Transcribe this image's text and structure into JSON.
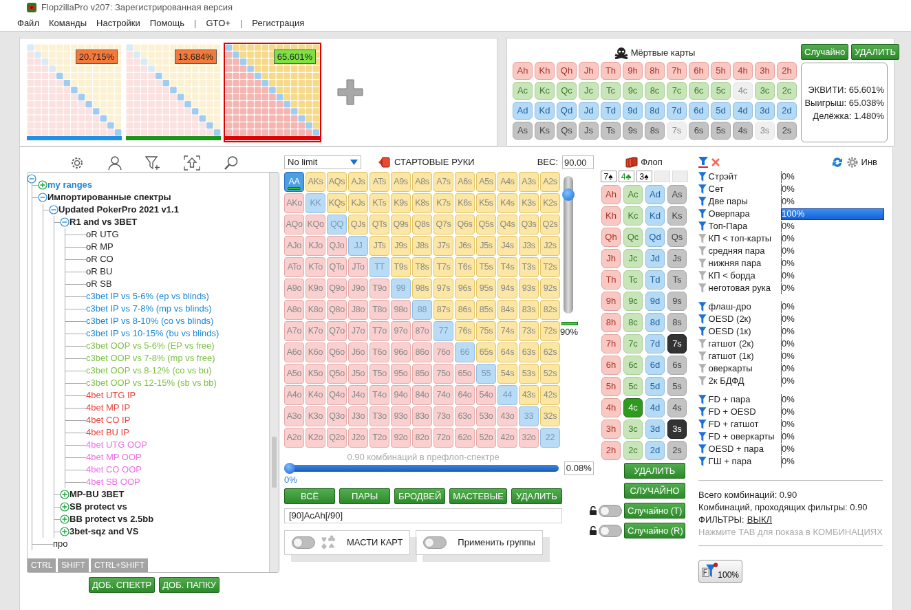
{
  "window": {
    "title": "FlopzillaPro v207: Зарегистрированная версия"
  },
  "menu": [
    {
      "label": "Файл",
      "kind": "item"
    },
    {
      "label": "Команды",
      "kind": "item"
    },
    {
      "label": "Настройки",
      "kind": "item"
    },
    {
      "label": "Помощь",
      "kind": "item"
    },
    {
      "label": "|",
      "kind": "separator"
    },
    {
      "label": "GTO+",
      "kind": "item"
    },
    {
      "label": "|",
      "kind": "separator"
    },
    {
      "label": "Регистрация",
      "kind": "item"
    }
  ],
  "ranges": [
    {
      "percent": "20.715%",
      "color": "#1e90e8",
      "selected": false
    },
    {
      "percent": "13.684%",
      "color": "#1a951a",
      "selected": false
    },
    {
      "percent": "65.601%",
      "color": "#e00000",
      "selected": true
    }
  ],
  "dead_cards": {
    "title": "Мёртвые карты",
    "buttons": [
      "Случайно",
      "УДАЛИТЬ"
    ],
    "rows": [
      {
        "kind": "hearts",
        "cards": [
          {
            "label": "Ah",
            "disabled": false
          },
          {
            "label": "Kh",
            "disabled": false
          },
          {
            "label": "Qh",
            "disabled": false
          },
          {
            "label": "Jh",
            "disabled": false
          },
          {
            "label": "Th",
            "disabled": false
          },
          {
            "label": "9h",
            "disabled": false
          },
          {
            "label": "8h",
            "disabled": false
          },
          {
            "label": "7h",
            "disabled": false
          },
          {
            "label": "6h",
            "disabled": false
          },
          {
            "label": "5h",
            "disabled": false
          },
          {
            "label": "4h",
            "disabled": false
          },
          {
            "label": "3h",
            "disabled": false
          },
          {
            "label": "2h",
            "disabled": false
          }
        ]
      },
      {
        "kind": "clubs",
        "cards": [
          {
            "label": "Ac",
            "disabled": false
          },
          {
            "label": "Kc",
            "disabled": false
          },
          {
            "label": "Qc",
            "disabled": false
          },
          {
            "label": "Jc",
            "disabled": false
          },
          {
            "label": "Tc",
            "disabled": false
          },
          {
            "label": "9c",
            "disabled": false
          },
          {
            "label": "8c",
            "disabled": false
          },
          {
            "label": "7c",
            "disabled": false
          },
          {
            "label": "6c",
            "disabled": false
          },
          {
            "label": "5c",
            "disabled": false
          },
          {
            "label": "4c",
            "disabled": true
          },
          {
            "label": "3c",
            "disabled": false
          },
          {
            "label": "2c",
            "disabled": false
          }
        ]
      },
      {
        "kind": "diamonds",
        "cards": [
          {
            "label": "Ad",
            "disabled": false
          },
          {
            "label": "Kd",
            "disabled": false
          },
          {
            "label": "Qd",
            "disabled": false
          },
          {
            "label": "Jd",
            "disabled": false
          },
          {
            "label": "Td",
            "disabled": false
          },
          {
            "label": "9d",
            "disabled": false
          },
          {
            "label": "8d",
            "disabled": false
          },
          {
            "label": "7d",
            "disabled": false
          },
          {
            "label": "6d",
            "disabled": false
          },
          {
            "label": "5d",
            "disabled": false
          },
          {
            "label": "4d",
            "disabled": false
          },
          {
            "label": "3d",
            "disabled": false
          },
          {
            "label": "2d",
            "disabled": false
          }
        ]
      },
      {
        "kind": "spades",
        "cards": [
          {
            "label": "As",
            "disabled": false
          },
          {
            "label": "Ks",
            "disabled": false
          },
          {
            "label": "Qs",
            "disabled": false
          },
          {
            "label": "Js",
            "disabled": false
          },
          {
            "label": "Ts",
            "disabled": false
          },
          {
            "label": "9s",
            "disabled": false
          },
          {
            "label": "8s",
            "disabled": false
          },
          {
            "label": "7s",
            "disabled": true
          },
          {
            "label": "6s",
            "disabled": false
          },
          {
            "label": "5s",
            "disabled": false
          },
          {
            "label": "4s",
            "disabled": false
          },
          {
            "label": "3s",
            "disabled": true
          },
          {
            "label": "2s",
            "disabled": false
          }
        ]
      }
    ]
  },
  "equity": {
    "lines": [
      "ЭКВИТИ: 65.601%",
      "Выигрыш: 65.038%",
      "Делёжка: 1.480%"
    ]
  },
  "tree": {
    "expanded": true,
    "children": [
      {
        "label": "my ranges",
        "kind": "folder",
        "color": "#1a88d6",
        "expanded": false
      },
      {
        "label": "Импортированные спектры",
        "kind": "folder",
        "color": "#222222",
        "expanded": true,
        "children": [
          {
            "label": "Updated PokerPro 2021 v1.1",
            "kind": "folder",
            "color": "#222222",
            "expanded": true,
            "children": [
              {
                "label": "R1 and vs 3BET",
                "kind": "folder",
                "color": "#222222",
                "expanded": true,
                "children": [
                  {
                    "label": "oR UTG",
                    "kind": "range",
                    "color": "#222222"
                  },
                  {
                    "label": "oR MP",
                    "kind": "range",
                    "color": "#222222"
                  },
                  {
                    "label": "oR CO",
                    "kind": "range",
                    "color": "#222222"
                  },
                  {
                    "label": "oR BU",
                    "kind": "range",
                    "color": "#222222"
                  },
                  {
                    "label": "oR SB",
                    "kind": "range",
                    "color": "#222222"
                  },
                  {
                    "label": "c3bet IP vs 5-6% (ep vs blinds)",
                    "kind": "range",
                    "color": "#1a88d6"
                  },
                  {
                    "label": "c3bet IP vs 7-8% (mp vs blinds)",
                    "kind": "range",
                    "color": "#1a88d6"
                  },
                  {
                    "label": "c3bet IP vs 8-10% (co vs blinds)",
                    "kind": "range",
                    "color": "#1a88d6"
                  },
                  {
                    "label": "c3bet IP vs 10-15% (bu vs blinds)",
                    "kind": "range",
                    "color": "#1a88d6"
                  },
                  {
                    "label": "c3bet OOP vs 5-6% (EP vs free)",
                    "kind": "range",
                    "color": "#7cc142"
                  },
                  {
                    "label": "c3bet OOP vs 7-8% (mp vs free)",
                    "kind": "range",
                    "color": "#7cc142"
                  },
                  {
                    "label": "c3bet OOP vs 8-12% (co vs bu)",
                    "kind": "range",
                    "color": "#7cc142"
                  },
                  {
                    "label": "c3bet OOP vs 12-15% (sb vs bb)",
                    "kind": "range",
                    "color": "#7cc142"
                  },
                  {
                    "label": "4bet UTG IP",
                    "kind": "range",
                    "color": "#e8433a"
                  },
                  {
                    "label": "4bet MP IP",
                    "kind": "range",
                    "color": "#e8433a"
                  },
                  {
                    "label": "4bet CO IP",
                    "kind": "range",
                    "color": "#e8433a"
                  },
                  {
                    "label": "4bet BU IP",
                    "kind": "range",
                    "color": "#e8433a"
                  },
                  {
                    "label": "4bet UTG OOP",
                    "kind": "range",
                    "color": "#ee6fe8"
                  },
                  {
                    "label": "4bet MP OOP",
                    "kind": "range",
                    "color": "#ee6fe8"
                  },
                  {
                    "label": "4bet CO OOP",
                    "kind": "range",
                    "color": "#ee6fe8"
                  },
                  {
                    "label": "4bet SB OOP",
                    "kind": "range",
                    "color": "#ee6fe8"
                  }
                ]
              },
              {
                "label": "MP-BU 3BET",
                "kind": "folder",
                "color": "#222222",
                "expanded": false
              },
              {
                "label": "SB protect vs",
                "kind": "folder",
                "color": "#222222",
                "expanded": false
              },
              {
                "label": "BB protect vs 2.5bb",
                "kind": "folder",
                "color": "#222222",
                "expanded": false
              },
              {
                "label": "3bet-sqz and VS",
                "kind": "folder",
                "color": "#222222",
                "expanded": false
              }
            ]
          }
        ]
      },
      {
        "label": "про",
        "kind": "range",
        "color": "#222222"
      }
    ]
  },
  "tree_tabs": [
    "CTRL",
    "SHIFT",
    "CTRL+SHIFT"
  ],
  "tree_buttons": [
    "ДОБ. СПЕКТР",
    "ДОБ. ПАПКУ"
  ],
  "hands": {
    "game": "No limit",
    "title": "СТАРТОВЫЕ РУКИ",
    "weight_label": "ВЕС:",
    "weight": "90.00",
    "matrix": [
      [
        {
          "label": "AA",
          "selected": true
        },
        {
          "label": "AKs",
          "selected": false
        },
        {
          "label": "AQs",
          "selected": false
        },
        {
          "label": "AJs",
          "selected": false
        },
        {
          "label": "ATs",
          "selected": false
        },
        {
          "label": "A9s",
          "selected": false
        },
        {
          "label": "A8s",
          "selected": false
        },
        {
          "label": "A7s",
          "selected": false
        },
        {
          "label": "A6s",
          "selected": false
        },
        {
          "label": "A5s",
          "selected": false
        },
        {
          "label": "A4s",
          "selected": false
        },
        {
          "label": "A3s",
          "selected": false
        },
        {
          "label": "A2s",
          "selected": false
        }
      ],
      [
        {
          "label": "AKo",
          "selected": false
        },
        {
          "label": "KK",
          "selected": false
        },
        {
          "label": "KQs",
          "selected": false
        },
        {
          "label": "KJs",
          "selected": false
        },
        {
          "label": "KTs",
          "selected": false
        },
        {
          "label": "K9s",
          "selected": false
        },
        {
          "label": "K8s",
          "selected": false
        },
        {
          "label": "K7s",
          "selected": false
        },
        {
          "label": "K6s",
          "selected": false
        },
        {
          "label": "K5s",
          "selected": false
        },
        {
          "label": "K4s",
          "selected": false
        },
        {
          "label": "K3s",
          "selected": false
        },
        {
          "label": "K2s",
          "selected": false
        }
      ],
      [
        {
          "label": "AQo",
          "selected": false
        },
        {
          "label": "KQo",
          "selected": false
        },
        {
          "label": "QQ",
          "selected": false
        },
        {
          "label": "QJs",
          "selected": false
        },
        {
          "label": "QTs",
          "selected": false
        },
        {
          "label": "Q9s",
          "selected": false
        },
        {
          "label": "Q8s",
          "selected": false
        },
        {
          "label": "Q7s",
          "selected": false
        },
        {
          "label": "Q6s",
          "selected": false
        },
        {
          "label": "Q5s",
          "selected": false
        },
        {
          "label": "Q4s",
          "selected": false
        },
        {
          "label": "Q3s",
          "selected": false
        },
        {
          "label": "Q2s",
          "selected": false
        }
      ],
      [
        {
          "label": "AJo",
          "selected": false
        },
        {
          "label": "KJo",
          "selected": false
        },
        {
          "label": "QJo",
          "selected": false
        },
        {
          "label": "JJ",
          "selected": false
        },
        {
          "label": "JTs",
          "selected": false
        },
        {
          "label": "J9s",
          "selected": false
        },
        {
          "label": "J8s",
          "selected": false
        },
        {
          "label": "J7s",
          "selected": false
        },
        {
          "label": "J6s",
          "selected": false
        },
        {
          "label": "J5s",
          "selected": false
        },
        {
          "label": "J4s",
          "selected": false
        },
        {
          "label": "J3s",
          "selected": false
        },
        {
          "label": "J2s",
          "selected": false
        }
      ],
      [
        {
          "label": "ATo",
          "selected": false
        },
        {
          "label": "KTo",
          "selected": false
        },
        {
          "label": "QTo",
          "selected": false
        },
        {
          "label": "JTo",
          "selected": false
        },
        {
          "label": "TT",
          "selected": false
        },
        {
          "label": "T9s",
          "selected": false
        },
        {
          "label": "T8s",
          "selected": false
        },
        {
          "label": "T7s",
          "selected": false
        },
        {
          "label": "T6s",
          "selected": false
        },
        {
          "label": "T5s",
          "selected": false
        },
        {
          "label": "T4s",
          "selected": false
        },
        {
          "label": "T3s",
          "selected": false
        },
        {
          "label": "T2s",
          "selected": false
        }
      ],
      [
        {
          "label": "A9o",
          "selected": false
        },
        {
          "label": "K9o",
          "selected": false
        },
        {
          "label": "Q9o",
          "selected": false
        },
        {
          "label": "J9o",
          "selected": false
        },
        {
          "label": "T9o",
          "selected": false
        },
        {
          "label": "99",
          "selected": false
        },
        {
          "label": "98s",
          "selected": false
        },
        {
          "label": "97s",
          "selected": false
        },
        {
          "label": "96s",
          "selected": false
        },
        {
          "label": "95s",
          "selected": false
        },
        {
          "label": "94s",
          "selected": false
        },
        {
          "label": "93s",
          "selected": false
        },
        {
          "label": "92s",
          "selected": false
        }
      ],
      [
        {
          "label": "A8o",
          "selected": false
        },
        {
          "label": "K8o",
          "selected": false
        },
        {
          "label": "Q8o",
          "selected": false
        },
        {
          "label": "J8o",
          "selected": false
        },
        {
          "label": "T8o",
          "selected": false
        },
        {
          "label": "98o",
          "selected": false
        },
        {
          "label": "88",
          "selected": false
        },
        {
          "label": "87s",
          "selected": false
        },
        {
          "label": "86s",
          "selected": false
        },
        {
          "label": "85s",
          "selected": false
        },
        {
          "label": "84s",
          "selected": false
        },
        {
          "label": "83s",
          "selected": false
        },
        {
          "label": "82s",
          "selected": false
        }
      ],
      [
        {
          "label": "A7o",
          "selected": false
        },
        {
          "label": "K7o",
          "selected": false
        },
        {
          "label": "Q7o",
          "selected": false
        },
        {
          "label": "J7o",
          "selected": false
        },
        {
          "label": "T7o",
          "selected": false
        },
        {
          "label": "97o",
          "selected": false
        },
        {
          "label": "87o",
          "selected": false
        },
        {
          "label": "77",
          "selected": false
        },
        {
          "label": "76s",
          "selected": false
        },
        {
          "label": "75s",
          "selected": false
        },
        {
          "label": "74s",
          "selected": false
        },
        {
          "label": "73s",
          "selected": false
        },
        {
          "label": "72s",
          "selected": false
        }
      ],
      [
        {
          "label": "A6o",
          "selected": false
        },
        {
          "label": "K6o",
          "selected": false
        },
        {
          "label": "Q6o",
          "selected": false
        },
        {
          "label": "J6o",
          "selected": false
        },
        {
          "label": "T6o",
          "selected": false
        },
        {
          "label": "96o",
          "selected": false
        },
        {
          "label": "86o",
          "selected": false
        },
        {
          "label": "76o",
          "selected": false
        },
        {
          "label": "66",
          "selected": false
        },
        {
          "label": "65s",
          "selected": false
        },
        {
          "label": "64s",
          "selected": false
        },
        {
          "label": "63s",
          "selected": false
        },
        {
          "label": "62s",
          "selected": false
        }
      ],
      [
        {
          "label": "A5o",
          "selected": false
        },
        {
          "label": "K5o",
          "selected": false
        },
        {
          "label": "Q5o",
          "selected": false
        },
        {
          "label": "J5o",
          "selected": false
        },
        {
          "label": "T5o",
          "selected": false
        },
        {
          "label": "95o",
          "selected": false
        },
        {
          "label": "85o",
          "selected": false
        },
        {
          "label": "75o",
          "selected": false
        },
        {
          "label": "65o",
          "selected": false
        },
        {
          "label": "55",
          "selected": false
        },
        {
          "label": "54s",
          "selected": false
        },
        {
          "label": "53s",
          "selected": false
        },
        {
          "label": "52s",
          "selected": false
        }
      ],
      [
        {
          "label": "A4o",
          "selected": false
        },
        {
          "label": "K4o",
          "selected": false
        },
        {
          "label": "Q4o",
          "selected": false
        },
        {
          "label": "J4o",
          "selected": false
        },
        {
          "label": "T4o",
          "selected": false
        },
        {
          "label": "94o",
          "selected": false
        },
        {
          "label": "84o",
          "selected": false
        },
        {
          "label": "74o",
          "selected": false
        },
        {
          "label": "64o",
          "selected": false
        },
        {
          "label": "54o",
          "selected": false
        },
        {
          "label": "44",
          "selected": false
        },
        {
          "label": "43s",
          "selected": false
        },
        {
          "label": "42s",
          "selected": false
        }
      ],
      [
        {
          "label": "A3o",
          "selected": false
        },
        {
          "label": "K3o",
          "selected": false
        },
        {
          "label": "Q3o",
          "selected": false
        },
        {
          "label": "J3o",
          "selected": false
        },
        {
          "label": "T3o",
          "selected": false
        },
        {
          "label": "93o",
          "selected": false
        },
        {
          "label": "83o",
          "selected": false
        },
        {
          "label": "73o",
          "selected": false
        },
        {
          "label": "63o",
          "selected": false
        },
        {
          "label": "53o",
          "selected": false
        },
        {
          "label": "43o",
          "selected": false
        },
        {
          "label": "33",
          "selected": false
        },
        {
          "label": "32s",
          "selected": false
        }
      ],
      [
        {
          "label": "A2o",
          "selected": false
        },
        {
          "label": "K2o",
          "selected": false
        },
        {
          "label": "Q2o",
          "selected": false
        },
        {
          "label": "J2o",
          "selected": false
        },
        {
          "label": "T2o",
          "selected": false
        },
        {
          "label": "92o",
          "selected": false
        },
        {
          "label": "82o",
          "selected": false
        },
        {
          "label": "72o",
          "selected": false
        },
        {
          "label": "62o",
          "selected": false
        },
        {
          "label": "52o",
          "selected": false
        },
        {
          "label": "42o",
          "selected": false
        },
        {
          "label": "32o",
          "selected": false
        },
        {
          "label": "22",
          "selected": false
        }
      ]
    ],
    "weight_slider": {
      "level": 0.9,
      "reading": "90%"
    },
    "combos_caption": "0.90 комбинаций в префлоп-спектре",
    "range_slider": {
      "level": 0,
      "min_label": "0%",
      "value": "0.08%"
    },
    "buttons": [
      "ВСЁ",
      "ПАРЫ",
      "БРОДВЕЙ",
      "МАСТЕВЫЕ",
      "УДАЛИТЬ"
    ],
    "range_text": "[90]AcAh[/90]",
    "toggles": [
      {
        "label": "МАСТИ КАРТ",
        "on": false,
        "kind": "suits"
      },
      {
        "label": "Применить группы",
        "on": false,
        "kind": "plain"
      }
    ]
  },
  "flop": {
    "title": "Флоп",
    "board": [
      {
        "label": "7♠",
        "color": "#000000"
      },
      {
        "label": "4♣",
        "color": "#1a8a1a"
      },
      {
        "label": "3♠",
        "color": "#000000"
      }
    ],
    "columns": [
      {
        "kind": "hearts",
        "cards": [
          {
            "label": "Ah",
            "selected": false
          },
          {
            "label": "Kh",
            "selected": false
          },
          {
            "label": "Qh",
            "selected": false
          },
          {
            "label": "Jh",
            "selected": false
          },
          {
            "label": "Th",
            "selected": false
          },
          {
            "label": "9h",
            "selected": false
          },
          {
            "label": "8h",
            "selected": false
          },
          {
            "label": "7h",
            "selected": false
          },
          {
            "label": "6h",
            "selected": false
          },
          {
            "label": "5h",
            "selected": false
          },
          {
            "label": "4h",
            "selected": false
          },
          {
            "label": "3h",
            "selected": false
          },
          {
            "label": "2h",
            "selected": false
          }
        ]
      },
      {
        "kind": "clubs",
        "cards": [
          {
            "label": "Ac",
            "selected": false
          },
          {
            "label": "Kc",
            "selected": false
          },
          {
            "label": "Qc",
            "selected": false
          },
          {
            "label": "Jc",
            "selected": false
          },
          {
            "label": "Tc",
            "selected": false
          },
          {
            "label": "9c",
            "selected": false
          },
          {
            "label": "8c",
            "selected": false
          },
          {
            "label": "7c",
            "selected": false
          },
          {
            "label": "6c",
            "selected": false
          },
          {
            "label": "5c",
            "selected": false
          },
          {
            "label": "4c",
            "selected": true
          },
          {
            "label": "3c",
            "selected": false
          },
          {
            "label": "2c",
            "selected": false
          }
        ]
      },
      {
        "kind": "diamonds",
        "cards": [
          {
            "label": "Ad",
            "selected": false
          },
          {
            "label": "Kd",
            "selected": false
          },
          {
            "label": "Qd",
            "selected": false
          },
          {
            "label": "Jd",
            "selected": false
          },
          {
            "label": "Td",
            "selected": false
          },
          {
            "label": "9d",
            "selected": false
          },
          {
            "label": "8d",
            "selected": false
          },
          {
            "label": "7d",
            "selected": false
          },
          {
            "label": "6d",
            "selected": false
          },
          {
            "label": "5d",
            "selected": false
          },
          {
            "label": "4d",
            "selected": false
          },
          {
            "label": "3d",
            "selected": false
          },
          {
            "label": "2d",
            "selected": false
          }
        ]
      },
      {
        "kind": "spades",
        "cards": [
          {
            "label": "As",
            "selected": false
          },
          {
            "label": "Ks",
            "selected": false
          },
          {
            "label": "Qs",
            "selected": false
          },
          {
            "label": "Js",
            "selected": false
          },
          {
            "label": "Ts",
            "selected": false
          },
          {
            "label": "9s",
            "selected": false
          },
          {
            "label": "8s",
            "selected": false
          },
          {
            "label": "7s",
            "selected": true
          },
          {
            "label": "6s",
            "selected": false
          },
          {
            "label": "5s",
            "selected": false
          },
          {
            "label": "4s",
            "selected": false
          },
          {
            "label": "3s",
            "selected": true
          },
          {
            "label": "2s",
            "selected": false
          }
        ]
      }
    ],
    "buttons": [
      {
        "label": "УДАЛИТЬ",
        "kind": "plain"
      },
      {
        "label": "СЛУЧАЙНО",
        "kind": "plain"
      },
      {
        "label": "Случайно (T)",
        "kind": "locked",
        "on": false
      },
      {
        "label": "Случайно (R)",
        "kind": "locked",
        "on": false
      }
    ]
  },
  "filters": {
    "invert_label": "Инв",
    "groups": [
      [
        {
          "label": "Стрэйт",
          "value": "0%",
          "active": true,
          "level": 0
        },
        {
          "label": "Сет",
          "value": "0%",
          "active": true,
          "level": 0
        },
        {
          "label": "Две пары",
          "value": "0%",
          "active": true,
          "level": 0
        },
        {
          "label": "Оверпара",
          "value": "100%",
          "active": true,
          "level": 1
        },
        {
          "label": "Топ-Пара",
          "value": "0%",
          "active": true,
          "level": 0
        },
        {
          "label": "КП < топ-карты",
          "value": "0%",
          "active": false,
          "level": 0
        },
        {
          "label": "средняя пара",
          "value": "0%",
          "active": false,
          "level": 0
        },
        {
          "label": "нижняя пара",
          "value": "0%",
          "active": false,
          "level": 0
        },
        {
          "label": "КП < борда",
          "value": "0%",
          "active": false,
          "level": 0
        },
        {
          "label": "неготовая рука",
          "value": "0%",
          "active": false,
          "level": 0
        }
      ],
      [
        {
          "label": "флаш-дро",
          "value": "0%",
          "active": true,
          "level": 0
        },
        {
          "label": "OESD (2к)",
          "value": "0%",
          "active": true,
          "level": 0
        },
        {
          "label": "OESD (1к)",
          "value": "0%",
          "active": true,
          "level": 0
        },
        {
          "label": "гатшот (2к)",
          "value": "0%",
          "active": false,
          "level": 0
        },
        {
          "label": "гатшот (1к)",
          "value": "0%",
          "active": false,
          "level": 0
        },
        {
          "label": "оверкарты",
          "value": "0%",
          "active": false,
          "level": 0
        },
        {
          "label": "2к БДФД",
          "value": "0%",
          "active": false,
          "level": 0
        }
      ],
      [
        {
          "label": "FD + пара",
          "value": "0%",
          "active": true,
          "level": 0
        },
        {
          "label": "FD + OESD",
          "value": "0%",
          "active": true,
          "level": 0
        },
        {
          "label": "FD + гатшот",
          "value": "0%",
          "active": true,
          "level": 0
        },
        {
          "label": "FD + оверкарты",
          "value": "0%",
          "active": true,
          "level": 0
        },
        {
          "label": "OESD + пара",
          "value": "0%",
          "active": true,
          "level": 0
        },
        {
          "label": "ГШ + пара",
          "value": "0%",
          "active": true,
          "level": 0
        }
      ]
    ],
    "summary": {
      "total": "Всего комбинаций: 0.90",
      "passing": "Комбинаций, проходящих фильтры: 0.90",
      "filters_label": "ФИЛЬТРЫ:",
      "filters_link": "ВЫКЛ",
      "hint": "Нажмите TAB для показа в КОМБИНАЦИЯХ"
    },
    "filter_button": "100%"
  }
}
